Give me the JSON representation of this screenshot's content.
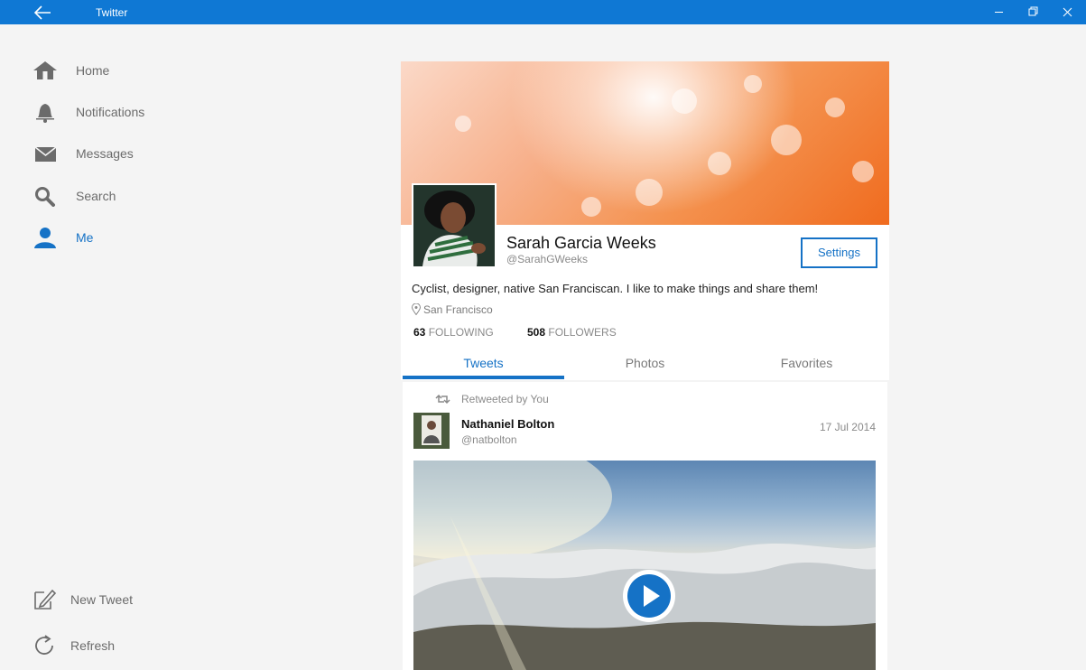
{
  "window": {
    "title": "Twitter"
  },
  "nav": {
    "items": [
      {
        "label": "Home",
        "icon": "home-icon"
      },
      {
        "label": "Notifications",
        "icon": "bell-icon"
      },
      {
        "label": "Messages",
        "icon": "mail-icon"
      },
      {
        "label": "Search",
        "icon": "search-icon"
      },
      {
        "label": "Me",
        "icon": "person-icon",
        "active": true
      }
    ],
    "bottom": [
      {
        "label": "New Tweet",
        "icon": "compose-icon"
      },
      {
        "label": "Refresh",
        "icon": "refresh-icon"
      }
    ]
  },
  "profile": {
    "name": "Sarah Garcia Weeks",
    "handle": "@SarahGWeeks",
    "settings_label": "Settings",
    "bio": "Cyclist, designer, native San Franciscan. I like to make things and share them!",
    "location": "San Francisco",
    "following_count": "63",
    "following_label": "FOLLOWING",
    "followers_count": "508",
    "followers_label": "FOLLOWERS"
  },
  "tabs": [
    {
      "label": "Tweets",
      "active": true
    },
    {
      "label": "Photos"
    },
    {
      "label": "Favorites"
    }
  ],
  "tweet": {
    "retweet_label": "Retweeted by You",
    "author_name": "Nathaniel Bolton",
    "author_handle": "@natbolton",
    "date": "17 Jul 2014"
  },
  "colors": {
    "accent": "#1572c6",
    "titlebar": "#0f78d4"
  }
}
